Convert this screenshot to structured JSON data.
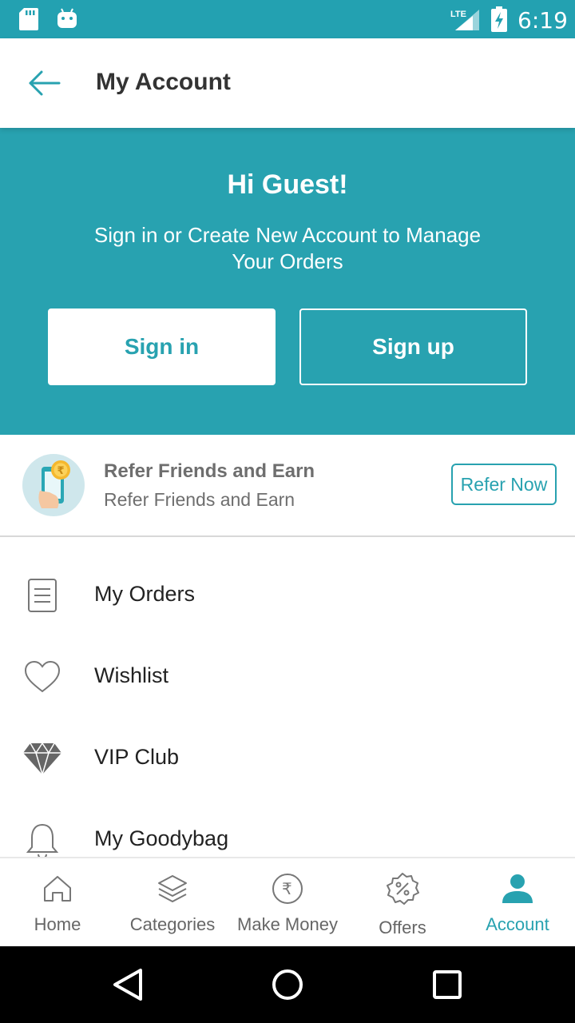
{
  "status_bar": {
    "time": "6:19",
    "network": "LTE",
    "icons": [
      "sd-card-icon",
      "android-icon",
      "signal-icon",
      "battery-charging-icon"
    ]
  },
  "app_bar": {
    "title": "My Account",
    "back_icon": "arrow-left-icon"
  },
  "hero": {
    "greeting": "Hi Guest!",
    "subtitle": "Sign in or Create New Account to Manage Your Orders",
    "signin_label": "Sign in",
    "signup_label": "Sign up"
  },
  "refer": {
    "title": "Refer Friends and Earn",
    "subtitle": "Refer Friends and Earn",
    "button_label": "Refer Now",
    "icon": "phone-rupee-icon"
  },
  "menu": {
    "items": [
      {
        "label": "My Orders",
        "icon": "orders-list-icon"
      },
      {
        "label": "Wishlist",
        "icon": "heart-icon"
      },
      {
        "label": "VIP Club",
        "icon": "diamond-icon"
      },
      {
        "label": "My Goodybag",
        "icon": "bell-icon"
      }
    ]
  },
  "bottom_nav": {
    "items": [
      {
        "label": "Home",
        "icon": "home-icon"
      },
      {
        "label": "Categories",
        "icon": "layers-icon"
      },
      {
        "label": "Make Money",
        "icon": "rupee-icon"
      },
      {
        "label": "Offers",
        "icon": "percent-badge-icon"
      },
      {
        "label": "Account",
        "icon": "person-icon",
        "active": true
      }
    ]
  },
  "colors": {
    "accent": "#28a2b0",
    "status_bar": "#23a1b1",
    "text_dark": "#222222",
    "text_muted": "#6e6e6e"
  }
}
